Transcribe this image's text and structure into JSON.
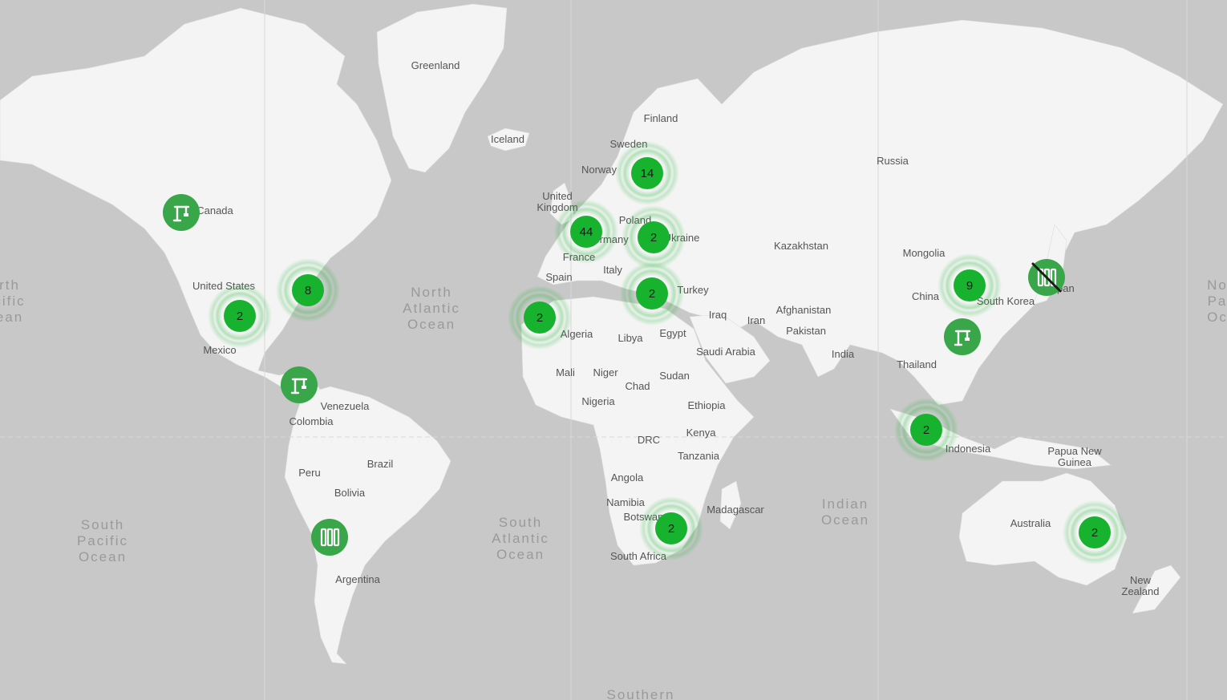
{
  "map": {
    "countries": [
      {
        "name": "Greenland",
        "lines": [
          "Greenland"
        ]
      },
      {
        "name": "Iceland",
        "lines": [
          "Iceland"
        ]
      },
      {
        "name": "Finland",
        "lines": [
          "Finland"
        ]
      },
      {
        "name": "Sweden",
        "lines": [
          "Sweden"
        ]
      },
      {
        "name": "Norway",
        "lines": [
          "Norway"
        ]
      },
      {
        "name": "Russia",
        "lines": [
          "Russia"
        ]
      },
      {
        "name": "United Kingdom",
        "lines": [
          "United",
          "Kingdom"
        ]
      },
      {
        "name": "Poland",
        "lines": [
          "Poland"
        ]
      },
      {
        "name": "Germany",
        "lines": [
          "Germany"
        ]
      },
      {
        "name": "Ukraine",
        "lines": [
          "Ukraine"
        ]
      },
      {
        "name": "France",
        "lines": [
          "France"
        ]
      },
      {
        "name": "Kazakhstan",
        "lines": [
          "Kazakhstan"
        ]
      },
      {
        "name": "Mongolia",
        "lines": [
          "Mongolia"
        ]
      },
      {
        "name": "Canada",
        "lines": [
          "Canada"
        ]
      },
      {
        "name": "United States",
        "lines": [
          "United States"
        ]
      },
      {
        "name": "Spain",
        "lines": [
          "Spain"
        ]
      },
      {
        "name": "Italy",
        "lines": [
          "Italy"
        ]
      },
      {
        "name": "Turkey",
        "lines": [
          "Turkey"
        ]
      },
      {
        "name": "China",
        "lines": [
          "China"
        ]
      },
      {
        "name": "South Korea",
        "lines": [
          "South Korea"
        ]
      },
      {
        "name": "Japan",
        "lines": [
          "Japan"
        ]
      },
      {
        "name": "Afghanistan",
        "lines": [
          "Afghanistan"
        ]
      },
      {
        "name": "Iraq",
        "lines": [
          "Iraq"
        ]
      },
      {
        "name": "Iran",
        "lines": [
          "Iran"
        ]
      },
      {
        "name": "Pakistan",
        "lines": [
          "Pakistan"
        ]
      },
      {
        "name": "Algeria",
        "lines": [
          "Algeria"
        ]
      },
      {
        "name": "Libya",
        "lines": [
          "Libya"
        ]
      },
      {
        "name": "Egypt",
        "lines": [
          "Egypt"
        ]
      },
      {
        "name": "Mexico",
        "lines": [
          "Mexico"
        ]
      },
      {
        "name": "Saudi Arabia",
        "lines": [
          "Saudi Arabia"
        ]
      },
      {
        "name": "India",
        "lines": [
          "India"
        ]
      },
      {
        "name": "Thailand",
        "lines": [
          "Thailand"
        ]
      },
      {
        "name": "Mali",
        "lines": [
          "Mali"
        ]
      },
      {
        "name": "Niger",
        "lines": [
          "Niger"
        ]
      },
      {
        "name": "Sudan",
        "lines": [
          "Sudan"
        ]
      },
      {
        "name": "Chad",
        "lines": [
          "Chad"
        ]
      },
      {
        "name": "Nigeria",
        "lines": [
          "Nigeria"
        ]
      },
      {
        "name": "Ethiopia",
        "lines": [
          "Ethiopia"
        ]
      },
      {
        "name": "Venezuela",
        "lines": [
          "Venezuela"
        ]
      },
      {
        "name": "Colombia",
        "lines": [
          "Colombia"
        ]
      },
      {
        "name": "Kenya",
        "lines": [
          "Kenya"
        ]
      },
      {
        "name": "DRC",
        "lines": [
          "DRC"
        ]
      },
      {
        "name": "Indonesia",
        "lines": [
          "Indonesia"
        ]
      },
      {
        "name": "Papua New Guinea",
        "lines": [
          "Papua New",
          "Guinea"
        ]
      },
      {
        "name": "Tanzania",
        "lines": [
          "Tanzania"
        ]
      },
      {
        "name": "Brazil",
        "lines": [
          "Brazil"
        ]
      },
      {
        "name": "Peru",
        "lines": [
          "Peru"
        ]
      },
      {
        "name": "Angola",
        "lines": [
          "Angola"
        ]
      },
      {
        "name": "Bolivia",
        "lines": [
          "Bolivia"
        ]
      },
      {
        "name": "Namibia",
        "lines": [
          "Namibia"
        ]
      },
      {
        "name": "Botswana",
        "lines": [
          "Botswana"
        ]
      },
      {
        "name": "Madagascar",
        "lines": [
          "Madagascar"
        ]
      },
      {
        "name": "Australia",
        "lines": [
          "Australia"
        ]
      },
      {
        "name": "South Africa",
        "lines": [
          "South Africa"
        ]
      },
      {
        "name": "Argentina",
        "lines": [
          "Argentina"
        ]
      },
      {
        "name": "New Zealand",
        "lines": [
          "New",
          "Zealand"
        ]
      }
    ],
    "oceans": [
      {
        "name": "North Atlantic Ocean",
        "lines": [
          "North",
          "Atlantic",
          "Ocean"
        ]
      },
      {
        "name": "South Atlantic Ocean",
        "lines": [
          "South",
          "Atlantic",
          "Ocean"
        ]
      },
      {
        "name": "South Pacific Ocean",
        "lines": [
          "South",
          "Pacific",
          "Ocean"
        ]
      },
      {
        "name": "Indian Ocean",
        "lines": [
          "Indian",
          "Ocean"
        ]
      },
      {
        "name": "North Pacific Ocean (west edge)",
        "lines": [
          "rth",
          "cific",
          "ean"
        ]
      },
      {
        "name": "North Pacific Ocean (east edge)",
        "lines": [
          "No",
          "Pa",
          "Oc"
        ]
      },
      {
        "name": "Southern Ocean",
        "lines": [
          "Southern"
        ]
      }
    ],
    "clusters": [
      {
        "id": "northern-europe",
        "count": "14"
      },
      {
        "id": "western-europe",
        "count": "44"
      },
      {
        "id": "eastern-europe",
        "count": "2"
      },
      {
        "id": "east-us",
        "count": "8"
      },
      {
        "id": "south-us",
        "count": "2"
      },
      {
        "id": "north-africa",
        "count": "2"
      },
      {
        "id": "turkey",
        "count": "2"
      },
      {
        "id": "east-asia",
        "count": "9"
      },
      {
        "id": "indonesia",
        "count": "2"
      },
      {
        "id": "southern-africa",
        "count": "2"
      },
      {
        "id": "australia",
        "count": "2"
      }
    ],
    "markers": [
      {
        "id": "canada",
        "icon": "crane-icon",
        "status": "construction"
      },
      {
        "id": "central-america",
        "icon": "crane-icon",
        "status": "construction"
      },
      {
        "id": "china-coast",
        "icon": "crane-icon",
        "status": "construction"
      },
      {
        "id": "chile",
        "icon": "facility-icon",
        "status": "operational"
      },
      {
        "id": "japan",
        "icon": "facility-icon",
        "status": "closed"
      }
    ],
    "colors": {
      "water": "#c8c8c8",
      "land": "#f4f4f4",
      "cluster": "#17b32e",
      "marker": "#3aa64a",
      "label": "#555555",
      "ocean_label": "#9a9a9a"
    }
  }
}
